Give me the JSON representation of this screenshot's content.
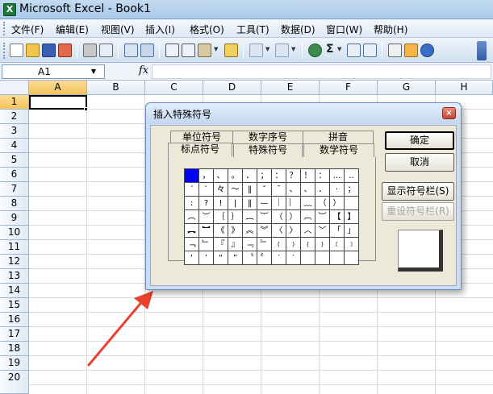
{
  "window": {
    "title": "Microsoft Excel - Book1",
    "app_icon_letter": "X"
  },
  "menu": [
    "文件(F)",
    "编辑(E)",
    "视图(V)",
    "插入(I)",
    "格式(O)",
    "工具(T)",
    "数据(D)",
    "窗口(W)",
    "帮助(H)"
  ],
  "toolbar": {
    "icons": [
      "new-icon",
      "open-icon",
      "save-icon",
      "permission-icon",
      "print-icon",
      "print-preview-icon",
      "spelling-icon",
      "research-icon",
      "cut-icon",
      "copy-icon",
      "paste-icon",
      "format-painter-icon",
      "undo-icon",
      "redo-icon",
      "hyperlink-icon",
      "autosum-icon",
      "sort-ascending-icon",
      "sort-descending-icon",
      "chart-wizard-icon",
      "drawing-icon",
      "help-icon"
    ],
    "autosum_glyph": "Σ"
  },
  "formula_bar": {
    "name_box": "A1",
    "fx": "fx",
    "formula": ""
  },
  "sheet": {
    "columns": [
      "A",
      "B",
      "C",
      "D",
      "E",
      "F",
      "G",
      "H"
    ],
    "rows": [
      "1",
      "2",
      "3",
      "4",
      "5",
      "6",
      "7",
      "8",
      "9",
      "10",
      "11",
      "12",
      "13",
      "14",
      "15",
      "16",
      "17",
      "18",
      "19",
      "20"
    ],
    "active_cell": "A1"
  },
  "dialog": {
    "title": "插入特殊符号",
    "close_glyph": "×",
    "tabs_back": [
      "单位符号",
      "数字序号",
      "拼音"
    ],
    "tabs_front": [
      "标点符号",
      "特殊符号",
      "数学符号"
    ],
    "active_tab": "标点符号",
    "symbols": [
      [
        "",
        "，",
        "、",
        "。",
        "．",
        "；",
        "：",
        "？",
        "！",
        "：",
        "…",
        "‥"
      ],
      [
        "ˊ",
        "ˋ",
        "々",
        "～",
        "‖",
        "ˇ",
        "ˉ",
        "、",
        "、",
        "．",
        "·",
        "；"
      ],
      [
        ":",
        "?",
        "!",
        "|",
        "‖",
        "—",
        "｜",
        "︴",
        "﹏",
        "（",
        "）",
        ""
      ],
      [
        "︵",
        "︶",
        "｛",
        "｝",
        "︷",
        "︸",
        "（",
        "）",
        "︹",
        "︺",
        "【",
        "】"
      ],
      [
        "︻",
        "︼",
        "《",
        "》",
        "︽",
        "︾",
        "〈",
        "〉",
        "︿",
        "﹀",
        "「",
        "」"
      ],
      [
        "﹁",
        "﹂",
        "『",
        "』",
        "﹃",
        "﹄",
        "﹙",
        "﹚",
        "﹛",
        "﹜",
        "﹝",
        "﹞"
      ],
      [
        "‘",
        "’",
        "“",
        "”",
        "〝",
        "〞",
        "‵",
        "′",
        "",
        "",
        "",
        ""
      ]
    ],
    "buttons": {
      "ok": "确定",
      "cancel": "取消",
      "show_bar": "显示符号栏(S)",
      "reset_bar": "重设符号栏(R)"
    }
  },
  "colors": {
    "selected_symbol": "#0000ff",
    "arrow": "#e8412c"
  }
}
